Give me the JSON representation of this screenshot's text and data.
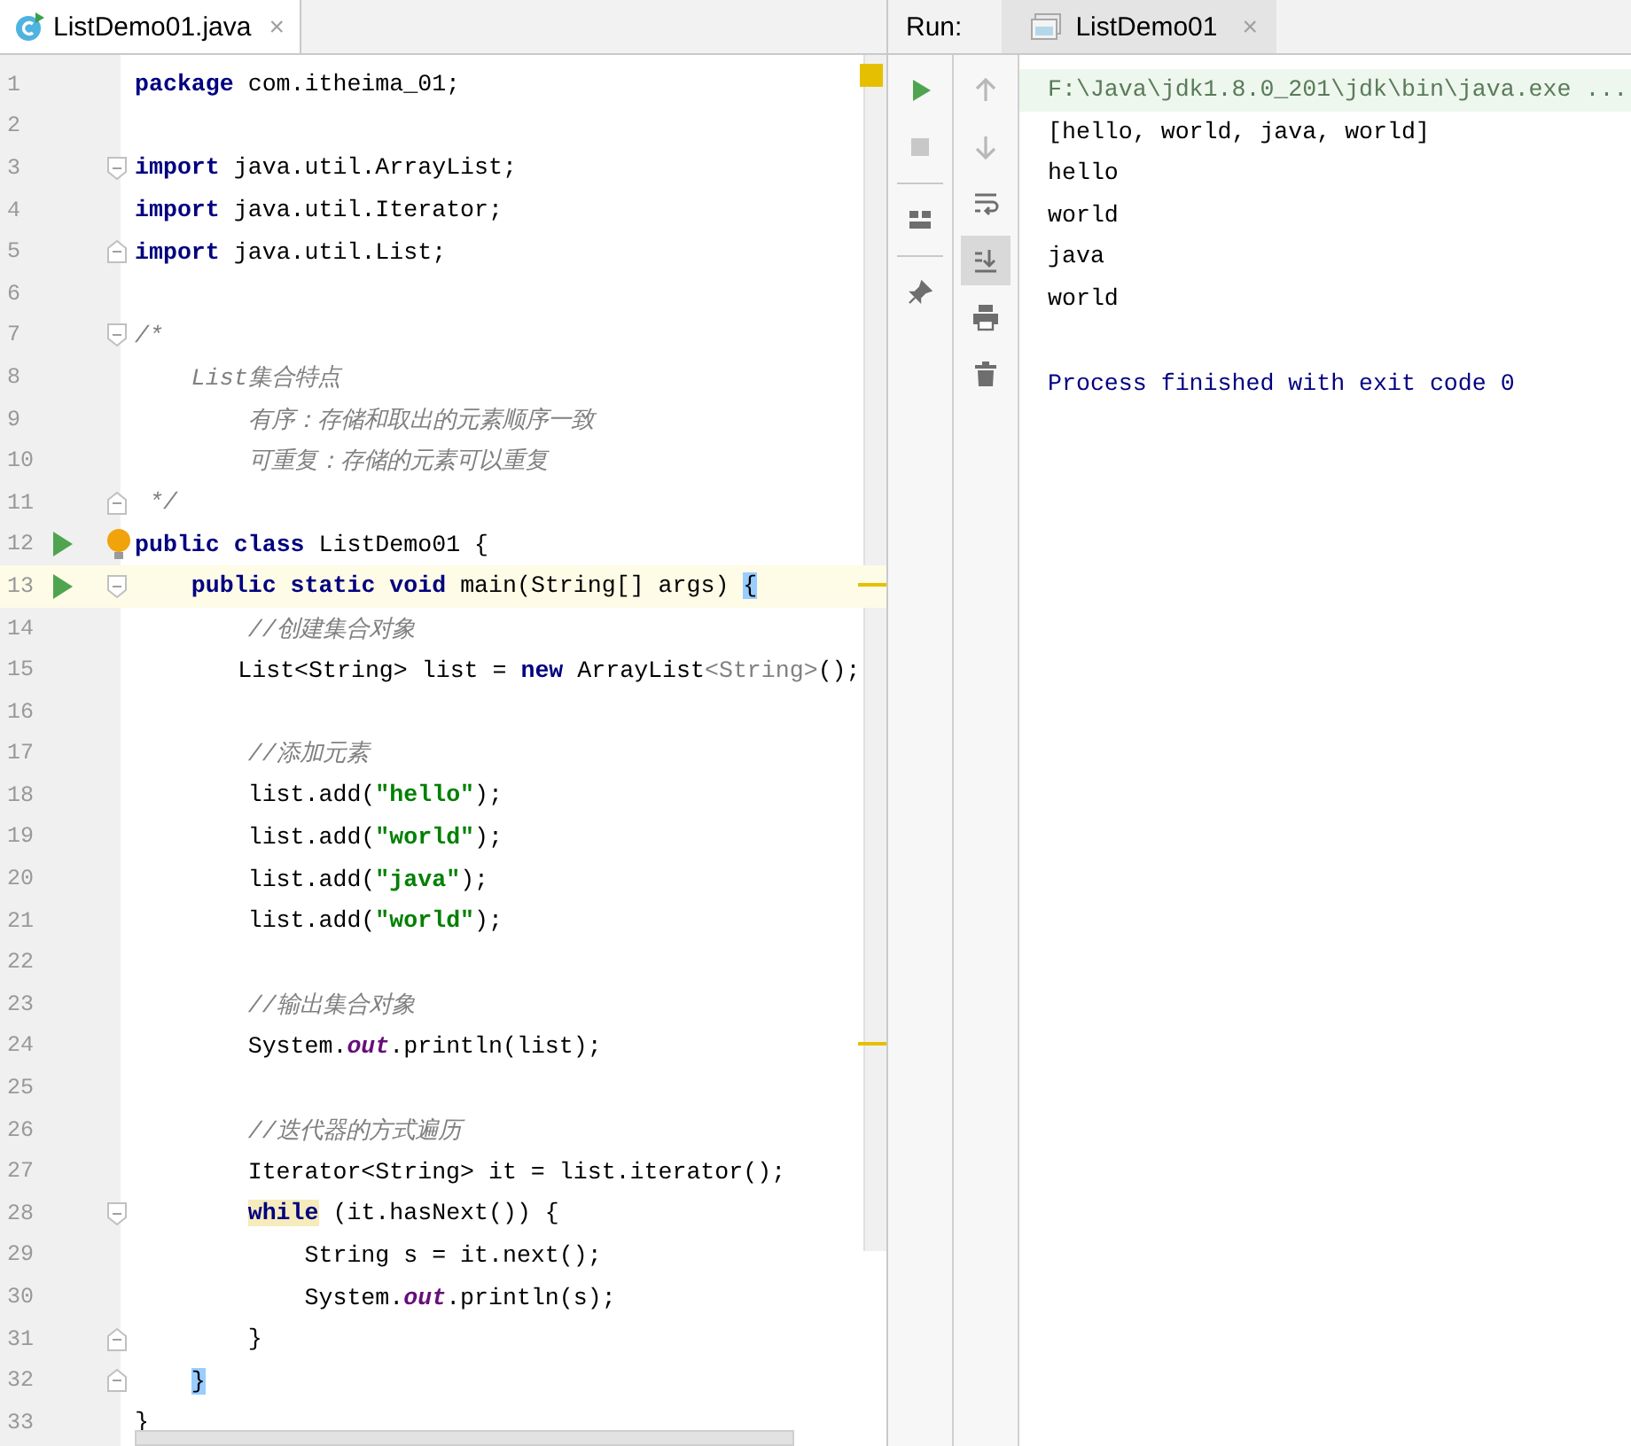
{
  "editor": {
    "tab": {
      "label": "ListDemo01.java",
      "close": "×",
      "selected": true
    },
    "lines": [
      {
        "number": "1",
        "tokens": [
          {
            "kind": "keyword",
            "text": "package"
          },
          {
            "kind": "plain",
            "text": " com.itheima_01;"
          }
        ]
      },
      {
        "number": "2"
      },
      {
        "number": "3",
        "fold_open": true,
        "tokens": [
          {
            "kind": "keyword",
            "text": "import"
          },
          {
            "kind": "plain",
            "text": " java.util.ArrayList;"
          }
        ]
      },
      {
        "number": "4",
        "tokens": [
          {
            "kind": "keyword",
            "text": "import"
          },
          {
            "kind": "plain",
            "text": " java.util.Iterator;"
          }
        ]
      },
      {
        "number": "5",
        "fold_close": true,
        "tokens": [
          {
            "kind": "keyword",
            "text": "import"
          },
          {
            "kind": "plain",
            "text": " java.util.List;"
          }
        ]
      },
      {
        "number": "6"
      },
      {
        "number": "7",
        "fold_open": true,
        "tokens": [
          {
            "kind": "comment",
            "text": "/*"
          }
        ]
      },
      {
        "number": "8",
        "tokens": [
          {
            "kind": "comment",
            "text": "    List集合特点"
          }
        ]
      },
      {
        "number": "9",
        "tokens": [
          {
            "kind": "comment",
            "text": "        有序：存储和取出的元素顺序一致"
          }
        ]
      },
      {
        "number": "10",
        "tokens": [
          {
            "kind": "comment",
            "text": "        可重复：存储的元素可以重复"
          }
        ]
      },
      {
        "number": "11",
        "fold_close": true,
        "tokens": [
          {
            "kind": "comment",
            "text": " */"
          }
        ]
      },
      {
        "number": "12",
        "run": true,
        "bulb": true,
        "tokens": [
          {
            "kind": "keyword",
            "text": "public"
          },
          {
            "kind": "keyword",
            "text": " class"
          },
          {
            "kind": "plain",
            "text": " ListDemo01 {"
          }
        ]
      },
      {
        "number": "13",
        "run": true,
        "current": true,
        "stripe_mark": true,
        "fold_open": true,
        "tokens": [
          {
            "kind": "keyword",
            "text": "    public"
          },
          {
            "kind": "keyword",
            "text": " static"
          },
          {
            "kind": "keyword",
            "text": " void"
          },
          {
            "kind": "plain",
            "text": " main(String[] args) "
          },
          {
            "kind": "brace_match",
            "text": "{"
          }
        ]
      },
      {
        "number": "14",
        "tokens": [
          {
            "kind": "comment",
            "text": "        //创建集合对象"
          }
        ]
      },
      {
        "number": "15",
        "tokens": [
          {
            "kind": "plain",
            "text": "        List<String> list = "
          },
          {
            "kind": "keyword",
            "text": "new"
          },
          {
            "kind": "plain",
            "text": " ArrayList"
          },
          {
            "kind": "unused",
            "text": "<String>"
          },
          {
            "kind": "plain",
            "text": "();"
          }
        ]
      },
      {
        "number": "16"
      },
      {
        "number": "17",
        "tokens": [
          {
            "kind": "comment",
            "text": "        //添加元素"
          }
        ]
      },
      {
        "number": "18",
        "tokens": [
          {
            "kind": "plain",
            "text": "        list.add("
          },
          {
            "kind": "string",
            "text": "\"hello\""
          },
          {
            "kind": "plain",
            "text": ");"
          }
        ]
      },
      {
        "number": "19",
        "tokens": [
          {
            "kind": "plain",
            "text": "        list.add("
          },
          {
            "kind": "string",
            "text": "\"world\""
          },
          {
            "kind": "plain",
            "text": ");"
          }
        ]
      },
      {
        "number": "20",
        "tokens": [
          {
            "kind": "plain",
            "text": "        list.add("
          },
          {
            "kind": "string",
            "text": "\"java\""
          },
          {
            "kind": "plain",
            "text": ");"
          }
        ]
      },
      {
        "number": "21",
        "tokens": [
          {
            "kind": "plain",
            "text": "        list.add("
          },
          {
            "kind": "string",
            "text": "\"world\""
          },
          {
            "kind": "plain",
            "text": ");"
          }
        ]
      },
      {
        "number": "22"
      },
      {
        "number": "23",
        "tokens": [
          {
            "kind": "comment",
            "text": "        //输出集合对象"
          }
        ]
      },
      {
        "number": "24",
        "stripe_mark": true,
        "tokens": [
          {
            "kind": "plain",
            "text": "        System."
          },
          {
            "kind": "field",
            "text": "out"
          },
          {
            "kind": "plain",
            "text": ".println(list);"
          }
        ]
      },
      {
        "number": "25"
      },
      {
        "number": "26",
        "tokens": [
          {
            "kind": "comment",
            "text": "        //迭代器的方式遍历"
          }
        ]
      },
      {
        "number": "27",
        "tokens": [
          {
            "kind": "plain",
            "text": "        Iterator<String> it = list.iterator();"
          }
        ]
      },
      {
        "number": "28",
        "fold_open": true,
        "tokens": [
          {
            "kind": "keyword_usage",
            "text": "        while"
          },
          {
            "kind": "plain",
            "text": " (it.hasNext()) {"
          }
        ]
      },
      {
        "number": "29",
        "tokens": [
          {
            "kind": "plain",
            "text": "            String s = it.next();"
          }
        ]
      },
      {
        "number": "30",
        "tokens": [
          {
            "kind": "plain",
            "text": "            System."
          },
          {
            "kind": "field",
            "text": "out"
          },
          {
            "kind": "plain",
            "text": ".println(s);"
          }
        ]
      },
      {
        "number": "31",
        "fold_close": true,
        "tokens": [
          {
            "kind": "plain",
            "text": "        }"
          }
        ]
      },
      {
        "number": "32",
        "fold_close": true,
        "tokens": [
          {
            "kind": "brace_match",
            "text": "    }"
          }
        ]
      },
      {
        "number": "33",
        "tokens": [
          {
            "kind": "plain",
            "text": "}"
          }
        ]
      }
    ]
  },
  "run": {
    "label": "Run:",
    "tab": {
      "label": "ListDemo01",
      "close": "×",
      "selected": true
    },
    "left_tools": [
      {
        "kind": "rerun",
        "disabled": false
      },
      {
        "kind": "stop",
        "disabled": true
      },
      {
        "kind": "divider"
      },
      {
        "kind": "layout",
        "disabled": false
      },
      {
        "kind": "divider"
      },
      {
        "kind": "pin",
        "disabled": false
      }
    ],
    "right_tools": [
      {
        "kind": "up",
        "disabled": true,
        "selected": false
      },
      {
        "kind": "down",
        "disabled": true,
        "selected": false
      },
      {
        "kind": "wrap",
        "disabled": false,
        "selected": false
      },
      {
        "kind": "scroll_end",
        "disabled": false,
        "selected": true
      },
      {
        "kind": "print",
        "disabled": false,
        "selected": false
      },
      {
        "kind": "trash",
        "disabled": false,
        "selected": false
      }
    ],
    "console": [
      {
        "kind": "command",
        "text": "F:\\Java\\jdk1.8.0_201\\jdk\\bin\\java.exe ..."
      },
      {
        "kind": "output",
        "text": "[hello, world, java, world]"
      },
      {
        "kind": "output",
        "text": "hello"
      },
      {
        "kind": "output",
        "text": "world"
      },
      {
        "kind": "output",
        "text": "java"
      },
      {
        "kind": "output",
        "text": "world"
      },
      {
        "kind": "status",
        "text": "Process finished with exit code 0"
      }
    ]
  }
}
